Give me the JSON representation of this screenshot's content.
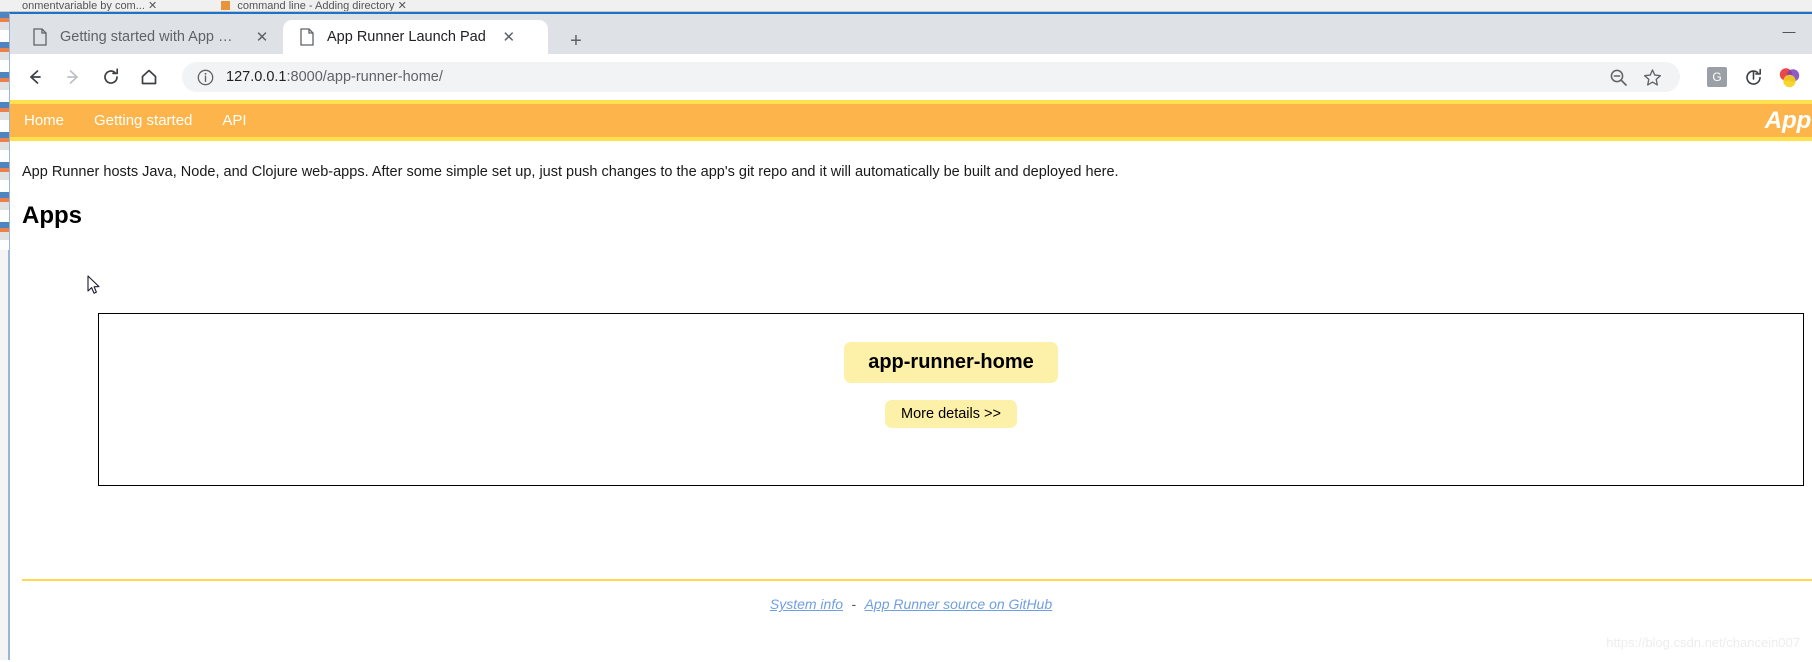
{
  "background_window": {
    "tabs": [
      {
        "label": "onmentvariable by com...",
        "icon": "document-icon"
      },
      {
        "label": "command line - Adding directory",
        "icon": "terminal-icon"
      }
    ]
  },
  "browser": {
    "tabs": [
      {
        "label": "Getting started with App Runner",
        "favicon": "page-icon",
        "close": "✕",
        "active": false
      },
      {
        "label": "App Runner Launch Pad",
        "favicon": "page-icon",
        "close": "✕",
        "active": true
      }
    ],
    "new_tab_label": "+",
    "window_controls": {
      "minimize": "—"
    },
    "toolbar": {
      "back_label": "←",
      "forward_label": "→",
      "reload_label": "⟳",
      "home_label": "⌂",
      "site_info_icon": "info-circle-icon",
      "url_host": "127.0.0.1",
      "url_port": ":8000",
      "url_path": "/app-runner-home/",
      "url_full": "127.0.0.1:8000/app-runner-home/",
      "zoom_out_icon": "zoom-out-icon",
      "bookmark_icon": "star-icon",
      "extensions": [
        {
          "name": "grammar-extension-icon",
          "label": "G"
        },
        {
          "name": "sync-extension-icon",
          "label": ""
        },
        {
          "name": "colorful-extension-icon",
          "label": ""
        }
      ]
    }
  },
  "page": {
    "navbar": {
      "links": [
        {
          "label": "Home"
        },
        {
          "label": "Getting started"
        },
        {
          "label": "API"
        }
      ],
      "brand": "App Ru",
      "background_color": "#fdb44b",
      "border_color": "#ffe14d"
    },
    "intro": "App Runner hosts Java, Node, and Clojure web-apps. After some simple set up, just push changes to the app's git repo and it will automatically be built and deployed here.",
    "heading": "Apps",
    "apps": [
      {
        "name": "app-runner-home",
        "details_label": "More details >>",
        "button_color": "#fdf0a8"
      }
    ],
    "footer": {
      "system_info_label": "System info",
      "separator": "-",
      "github_label": "App Runner source on GitHub",
      "link_color": "#6f9fe0"
    },
    "watermark": "https://blog.csdn.net/chancein007"
  }
}
